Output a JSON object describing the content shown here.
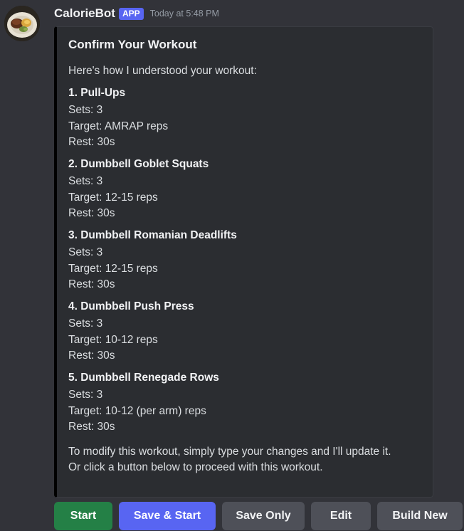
{
  "bot": {
    "username": "CalorieBot",
    "badge": "APP",
    "timestamp": "Today at 5:48 PM",
    "avatar_icon": "food-plate-icon"
  },
  "embed": {
    "accent_color": "#000000",
    "title": "Confirm Your Workout",
    "intro": "Here's how I understood your workout:",
    "exercises": [
      {
        "name": "1. Pull-Ups",
        "sets": "Sets: 3",
        "target": "Target: AMRAP reps",
        "rest": "Rest: 30s"
      },
      {
        "name": "2. Dumbbell Goblet Squats",
        "sets": "Sets: 3",
        "target": "Target: 12-15 reps",
        "rest": "Rest: 30s"
      },
      {
        "name": "3. Dumbbell Romanian Deadlifts",
        "sets": "Sets: 3",
        "target": "Target: 12-15 reps",
        "rest": "Rest: 30s"
      },
      {
        "name": "4. Dumbbell Push Press",
        "sets": "Sets: 3",
        "target": "Target: 10-12 reps",
        "rest": "Rest: 30s"
      },
      {
        "name": "5. Dumbbell Renegade Rows",
        "sets": "Sets: 3",
        "target": "Target: 10-12 (per arm) reps",
        "rest": "Rest: 30s"
      }
    ],
    "footer_line1": "To modify this workout, simply type your changes and I'll update it.",
    "footer_line2": "Or click a button below to proceed with this workout."
  },
  "buttons": {
    "start": "Start",
    "save_start": "Save & Start",
    "save_only": "Save Only",
    "edit": "Edit",
    "build_new": "Build New"
  },
  "colors": {
    "background": "#323339",
    "embed_background": "#2b2d31",
    "success": "#248046",
    "primary": "#5865f2",
    "secondary": "#4e5058"
  }
}
